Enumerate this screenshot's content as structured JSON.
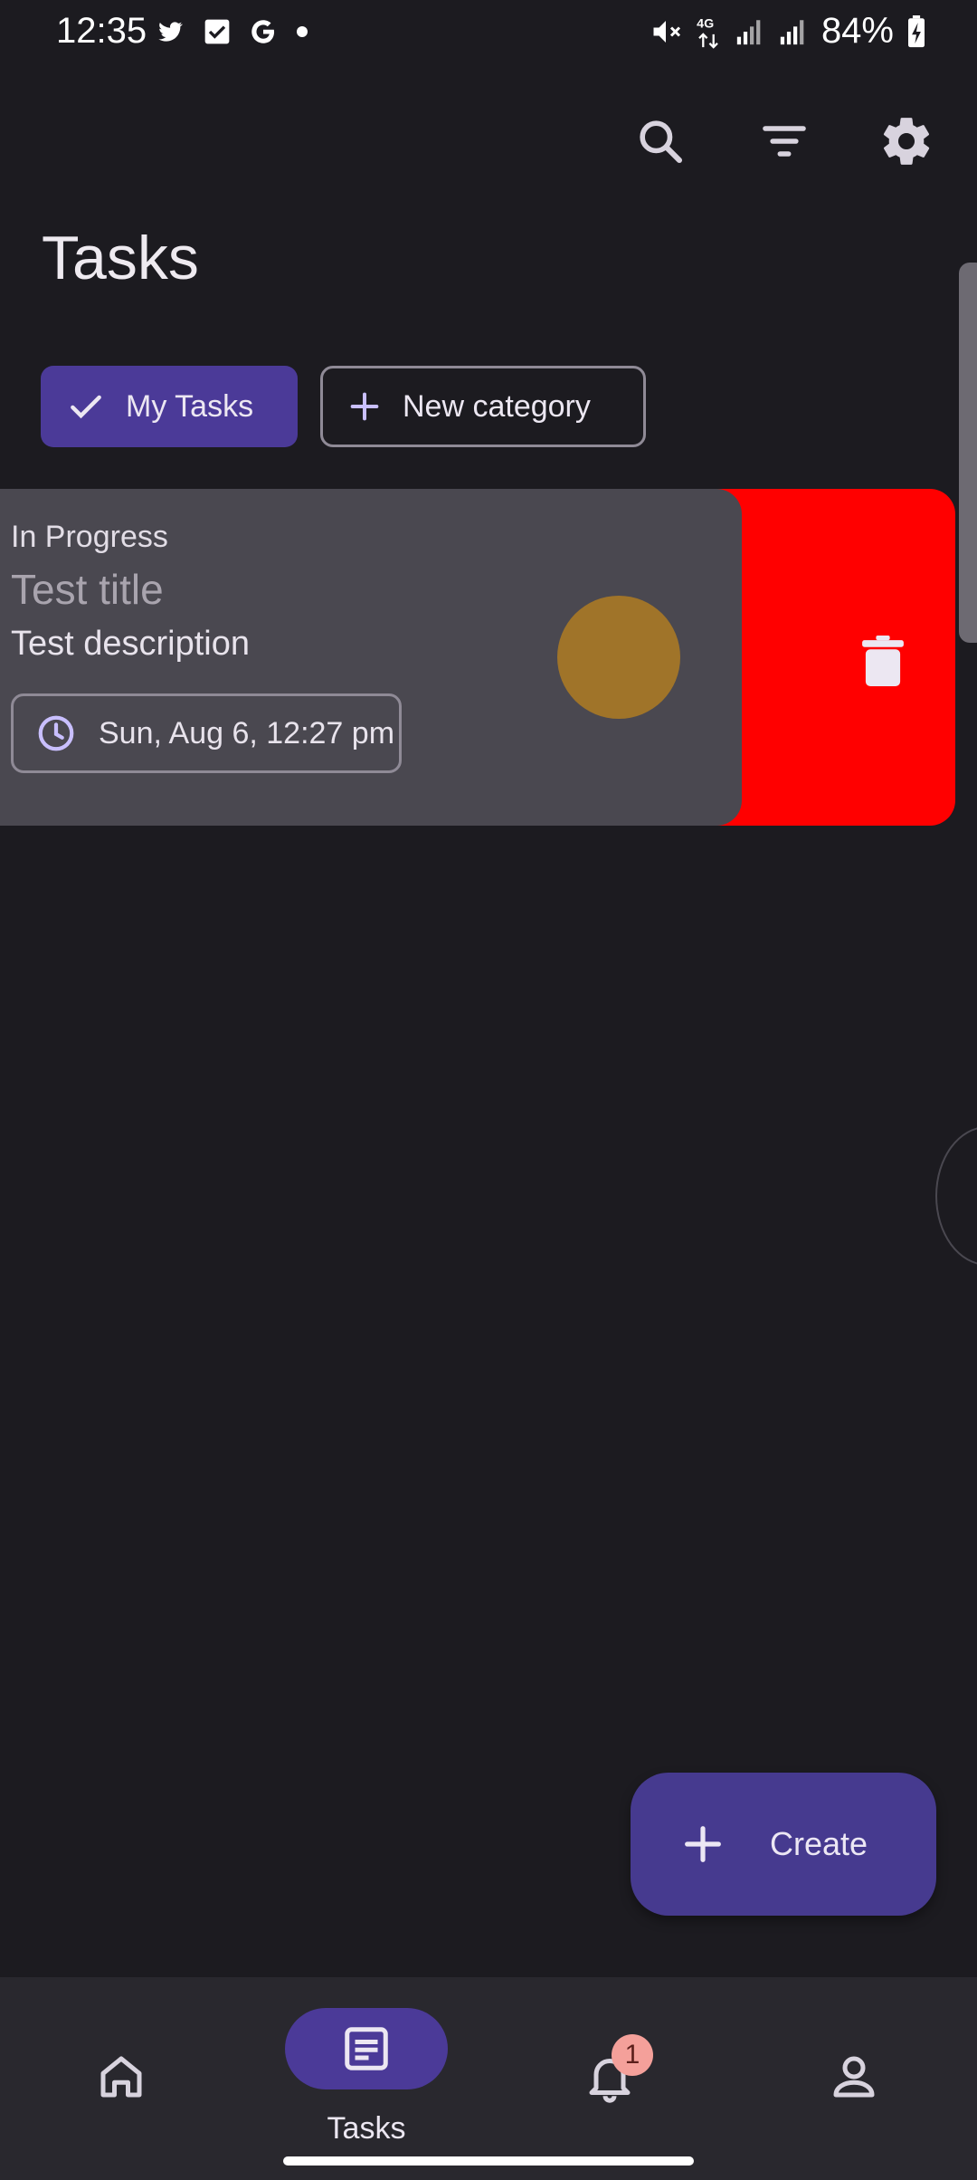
{
  "status_bar": {
    "time": "12:35",
    "battery": "84%",
    "left_icons": [
      "twitter-icon",
      "checkbox-icon",
      "google-icon",
      "dot-icon"
    ],
    "right_icons": [
      "mute-icon",
      "4g-icon",
      "signal-icon",
      "signal-icon",
      "battery-charging-icon"
    ]
  },
  "top_bar": {
    "actions": [
      "search-icon",
      "filter-icon",
      "settings-icon"
    ]
  },
  "page": {
    "title": "Tasks"
  },
  "chips": {
    "selected": {
      "label": "My Tasks",
      "icon": "check-icon"
    },
    "new_category": {
      "label": "New category",
      "icon": "plus-icon"
    }
  },
  "task": {
    "status": "In Progress",
    "title": "Test title",
    "description": "Test description",
    "due": "Sun, Aug 6, 12:27 pm",
    "color": "#a07429",
    "swipe_action": "delete-icon",
    "swipe_color": "#ff0000"
  },
  "fab": {
    "label": "Create",
    "icon": "plus-icon"
  },
  "bottom_nav": {
    "items": [
      {
        "icon": "home-icon",
        "label": ""
      },
      {
        "icon": "tasks-icon",
        "label": "Tasks",
        "selected": true
      },
      {
        "icon": "bell-icon",
        "label": "",
        "badge": "1"
      },
      {
        "icon": "person-icon",
        "label": ""
      }
    ]
  },
  "colors": {
    "background": "#1c1b20",
    "accent": "#4b3a98",
    "card": "#4a4850",
    "nav": "#29282e"
  }
}
